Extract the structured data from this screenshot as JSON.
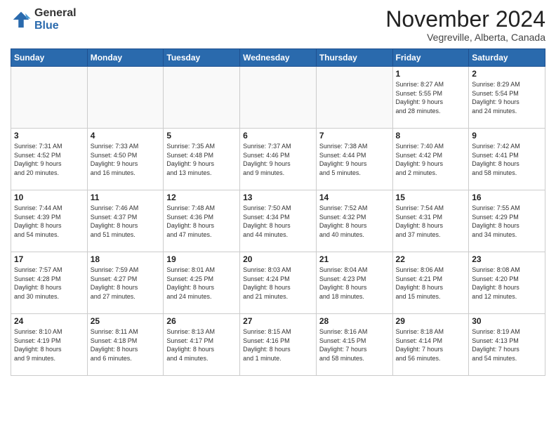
{
  "logo": {
    "general": "General",
    "blue": "Blue"
  },
  "title": "November 2024",
  "subtitle": "Vegreville, Alberta, Canada",
  "days_header": [
    "Sunday",
    "Monday",
    "Tuesday",
    "Wednesday",
    "Thursday",
    "Friday",
    "Saturday"
  ],
  "weeks": [
    [
      {
        "day": "",
        "info": ""
      },
      {
        "day": "",
        "info": ""
      },
      {
        "day": "",
        "info": ""
      },
      {
        "day": "",
        "info": ""
      },
      {
        "day": "",
        "info": ""
      },
      {
        "day": "1",
        "info": "Sunrise: 8:27 AM\nSunset: 5:55 PM\nDaylight: 9 hours\nand 28 minutes."
      },
      {
        "day": "2",
        "info": "Sunrise: 8:29 AM\nSunset: 5:54 PM\nDaylight: 9 hours\nand 24 minutes."
      }
    ],
    [
      {
        "day": "3",
        "info": "Sunrise: 7:31 AM\nSunset: 4:52 PM\nDaylight: 9 hours\nand 20 minutes."
      },
      {
        "day": "4",
        "info": "Sunrise: 7:33 AM\nSunset: 4:50 PM\nDaylight: 9 hours\nand 16 minutes."
      },
      {
        "day": "5",
        "info": "Sunrise: 7:35 AM\nSunset: 4:48 PM\nDaylight: 9 hours\nand 13 minutes."
      },
      {
        "day": "6",
        "info": "Sunrise: 7:37 AM\nSunset: 4:46 PM\nDaylight: 9 hours\nand 9 minutes."
      },
      {
        "day": "7",
        "info": "Sunrise: 7:38 AM\nSunset: 4:44 PM\nDaylight: 9 hours\nand 5 minutes."
      },
      {
        "day": "8",
        "info": "Sunrise: 7:40 AM\nSunset: 4:42 PM\nDaylight: 9 hours\nand 2 minutes."
      },
      {
        "day": "9",
        "info": "Sunrise: 7:42 AM\nSunset: 4:41 PM\nDaylight: 8 hours\nand 58 minutes."
      }
    ],
    [
      {
        "day": "10",
        "info": "Sunrise: 7:44 AM\nSunset: 4:39 PM\nDaylight: 8 hours\nand 54 minutes."
      },
      {
        "day": "11",
        "info": "Sunrise: 7:46 AM\nSunset: 4:37 PM\nDaylight: 8 hours\nand 51 minutes."
      },
      {
        "day": "12",
        "info": "Sunrise: 7:48 AM\nSunset: 4:36 PM\nDaylight: 8 hours\nand 47 minutes."
      },
      {
        "day": "13",
        "info": "Sunrise: 7:50 AM\nSunset: 4:34 PM\nDaylight: 8 hours\nand 44 minutes."
      },
      {
        "day": "14",
        "info": "Sunrise: 7:52 AM\nSunset: 4:32 PM\nDaylight: 8 hours\nand 40 minutes."
      },
      {
        "day": "15",
        "info": "Sunrise: 7:54 AM\nSunset: 4:31 PM\nDaylight: 8 hours\nand 37 minutes."
      },
      {
        "day": "16",
        "info": "Sunrise: 7:55 AM\nSunset: 4:29 PM\nDaylight: 8 hours\nand 34 minutes."
      }
    ],
    [
      {
        "day": "17",
        "info": "Sunrise: 7:57 AM\nSunset: 4:28 PM\nDaylight: 8 hours\nand 30 minutes."
      },
      {
        "day": "18",
        "info": "Sunrise: 7:59 AM\nSunset: 4:27 PM\nDaylight: 8 hours\nand 27 minutes."
      },
      {
        "day": "19",
        "info": "Sunrise: 8:01 AM\nSunset: 4:25 PM\nDaylight: 8 hours\nand 24 minutes."
      },
      {
        "day": "20",
        "info": "Sunrise: 8:03 AM\nSunset: 4:24 PM\nDaylight: 8 hours\nand 21 minutes."
      },
      {
        "day": "21",
        "info": "Sunrise: 8:04 AM\nSunset: 4:23 PM\nDaylight: 8 hours\nand 18 minutes."
      },
      {
        "day": "22",
        "info": "Sunrise: 8:06 AM\nSunset: 4:21 PM\nDaylight: 8 hours\nand 15 minutes."
      },
      {
        "day": "23",
        "info": "Sunrise: 8:08 AM\nSunset: 4:20 PM\nDaylight: 8 hours\nand 12 minutes."
      }
    ],
    [
      {
        "day": "24",
        "info": "Sunrise: 8:10 AM\nSunset: 4:19 PM\nDaylight: 8 hours\nand 9 minutes."
      },
      {
        "day": "25",
        "info": "Sunrise: 8:11 AM\nSunset: 4:18 PM\nDaylight: 8 hours\nand 6 minutes."
      },
      {
        "day": "26",
        "info": "Sunrise: 8:13 AM\nSunset: 4:17 PM\nDaylight: 8 hours\nand 4 minutes."
      },
      {
        "day": "27",
        "info": "Sunrise: 8:15 AM\nSunset: 4:16 PM\nDaylight: 8 hours\nand 1 minute."
      },
      {
        "day": "28",
        "info": "Sunrise: 8:16 AM\nSunset: 4:15 PM\nDaylight: 7 hours\nand 58 minutes."
      },
      {
        "day": "29",
        "info": "Sunrise: 8:18 AM\nSunset: 4:14 PM\nDaylight: 7 hours\nand 56 minutes."
      },
      {
        "day": "30",
        "info": "Sunrise: 8:19 AM\nSunset: 4:13 PM\nDaylight: 7 hours\nand 54 minutes."
      }
    ]
  ]
}
